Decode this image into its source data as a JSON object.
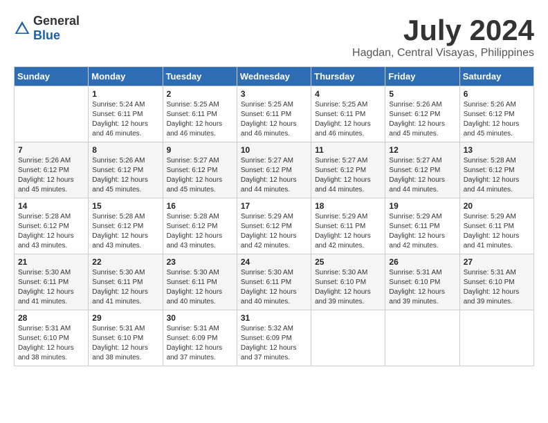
{
  "header": {
    "logo_general": "General",
    "logo_blue": "Blue",
    "month_year": "July 2024",
    "location": "Hagdan, Central Visayas, Philippines"
  },
  "weekdays": [
    "Sunday",
    "Monday",
    "Tuesday",
    "Wednesday",
    "Thursday",
    "Friday",
    "Saturday"
  ],
  "weeks": [
    [
      {
        "day": "",
        "sunrise": "",
        "sunset": "",
        "daylight": ""
      },
      {
        "day": "1",
        "sunrise": "Sunrise: 5:24 AM",
        "sunset": "Sunset: 6:11 PM",
        "daylight": "Daylight: 12 hours and 46 minutes."
      },
      {
        "day": "2",
        "sunrise": "Sunrise: 5:25 AM",
        "sunset": "Sunset: 6:11 PM",
        "daylight": "Daylight: 12 hours and 46 minutes."
      },
      {
        "day": "3",
        "sunrise": "Sunrise: 5:25 AM",
        "sunset": "Sunset: 6:11 PM",
        "daylight": "Daylight: 12 hours and 46 minutes."
      },
      {
        "day": "4",
        "sunrise": "Sunrise: 5:25 AM",
        "sunset": "Sunset: 6:11 PM",
        "daylight": "Daylight: 12 hours and 46 minutes."
      },
      {
        "day": "5",
        "sunrise": "Sunrise: 5:26 AM",
        "sunset": "Sunset: 6:12 PM",
        "daylight": "Daylight: 12 hours and 45 minutes."
      },
      {
        "day": "6",
        "sunrise": "Sunrise: 5:26 AM",
        "sunset": "Sunset: 6:12 PM",
        "daylight": "Daylight: 12 hours and 45 minutes."
      }
    ],
    [
      {
        "day": "7",
        "sunrise": "Sunrise: 5:26 AM",
        "sunset": "Sunset: 6:12 PM",
        "daylight": "Daylight: 12 hours and 45 minutes."
      },
      {
        "day": "8",
        "sunrise": "Sunrise: 5:26 AM",
        "sunset": "Sunset: 6:12 PM",
        "daylight": "Daylight: 12 hours and 45 minutes."
      },
      {
        "day": "9",
        "sunrise": "Sunrise: 5:27 AM",
        "sunset": "Sunset: 6:12 PM",
        "daylight": "Daylight: 12 hours and 45 minutes."
      },
      {
        "day": "10",
        "sunrise": "Sunrise: 5:27 AM",
        "sunset": "Sunset: 6:12 PM",
        "daylight": "Daylight: 12 hours and 44 minutes."
      },
      {
        "day": "11",
        "sunrise": "Sunrise: 5:27 AM",
        "sunset": "Sunset: 6:12 PM",
        "daylight": "Daylight: 12 hours and 44 minutes."
      },
      {
        "day": "12",
        "sunrise": "Sunrise: 5:27 AM",
        "sunset": "Sunset: 6:12 PM",
        "daylight": "Daylight: 12 hours and 44 minutes."
      },
      {
        "day": "13",
        "sunrise": "Sunrise: 5:28 AM",
        "sunset": "Sunset: 6:12 PM",
        "daylight": "Daylight: 12 hours and 44 minutes."
      }
    ],
    [
      {
        "day": "14",
        "sunrise": "Sunrise: 5:28 AM",
        "sunset": "Sunset: 6:12 PM",
        "daylight": "Daylight: 12 hours and 43 minutes."
      },
      {
        "day": "15",
        "sunrise": "Sunrise: 5:28 AM",
        "sunset": "Sunset: 6:12 PM",
        "daylight": "Daylight: 12 hours and 43 minutes."
      },
      {
        "day": "16",
        "sunrise": "Sunrise: 5:28 AM",
        "sunset": "Sunset: 6:12 PM",
        "daylight": "Daylight: 12 hours and 43 minutes."
      },
      {
        "day": "17",
        "sunrise": "Sunrise: 5:29 AM",
        "sunset": "Sunset: 6:12 PM",
        "daylight": "Daylight: 12 hours and 42 minutes."
      },
      {
        "day": "18",
        "sunrise": "Sunrise: 5:29 AM",
        "sunset": "Sunset: 6:11 PM",
        "daylight": "Daylight: 12 hours and 42 minutes."
      },
      {
        "day": "19",
        "sunrise": "Sunrise: 5:29 AM",
        "sunset": "Sunset: 6:11 PM",
        "daylight": "Daylight: 12 hours and 42 minutes."
      },
      {
        "day": "20",
        "sunrise": "Sunrise: 5:29 AM",
        "sunset": "Sunset: 6:11 PM",
        "daylight": "Daylight: 12 hours and 41 minutes."
      }
    ],
    [
      {
        "day": "21",
        "sunrise": "Sunrise: 5:30 AM",
        "sunset": "Sunset: 6:11 PM",
        "daylight": "Daylight: 12 hours and 41 minutes."
      },
      {
        "day": "22",
        "sunrise": "Sunrise: 5:30 AM",
        "sunset": "Sunset: 6:11 PM",
        "daylight": "Daylight: 12 hours and 41 minutes."
      },
      {
        "day": "23",
        "sunrise": "Sunrise: 5:30 AM",
        "sunset": "Sunset: 6:11 PM",
        "daylight": "Daylight: 12 hours and 40 minutes."
      },
      {
        "day": "24",
        "sunrise": "Sunrise: 5:30 AM",
        "sunset": "Sunset: 6:11 PM",
        "daylight": "Daylight: 12 hours and 40 minutes."
      },
      {
        "day": "25",
        "sunrise": "Sunrise: 5:30 AM",
        "sunset": "Sunset: 6:10 PM",
        "daylight": "Daylight: 12 hours and 39 minutes."
      },
      {
        "day": "26",
        "sunrise": "Sunrise: 5:31 AM",
        "sunset": "Sunset: 6:10 PM",
        "daylight": "Daylight: 12 hours and 39 minutes."
      },
      {
        "day": "27",
        "sunrise": "Sunrise: 5:31 AM",
        "sunset": "Sunset: 6:10 PM",
        "daylight": "Daylight: 12 hours and 39 minutes."
      }
    ],
    [
      {
        "day": "28",
        "sunrise": "Sunrise: 5:31 AM",
        "sunset": "Sunset: 6:10 PM",
        "daylight": "Daylight: 12 hours and 38 minutes."
      },
      {
        "day": "29",
        "sunrise": "Sunrise: 5:31 AM",
        "sunset": "Sunset: 6:10 PM",
        "daylight": "Daylight: 12 hours and 38 minutes."
      },
      {
        "day": "30",
        "sunrise": "Sunrise: 5:31 AM",
        "sunset": "Sunset: 6:09 PM",
        "daylight": "Daylight: 12 hours and 37 minutes."
      },
      {
        "day": "31",
        "sunrise": "Sunrise: 5:32 AM",
        "sunset": "Sunset: 6:09 PM",
        "daylight": "Daylight: 12 hours and 37 minutes."
      },
      {
        "day": "",
        "sunrise": "",
        "sunset": "",
        "daylight": ""
      },
      {
        "day": "",
        "sunrise": "",
        "sunset": "",
        "daylight": ""
      },
      {
        "day": "",
        "sunrise": "",
        "sunset": "",
        "daylight": ""
      }
    ]
  ]
}
